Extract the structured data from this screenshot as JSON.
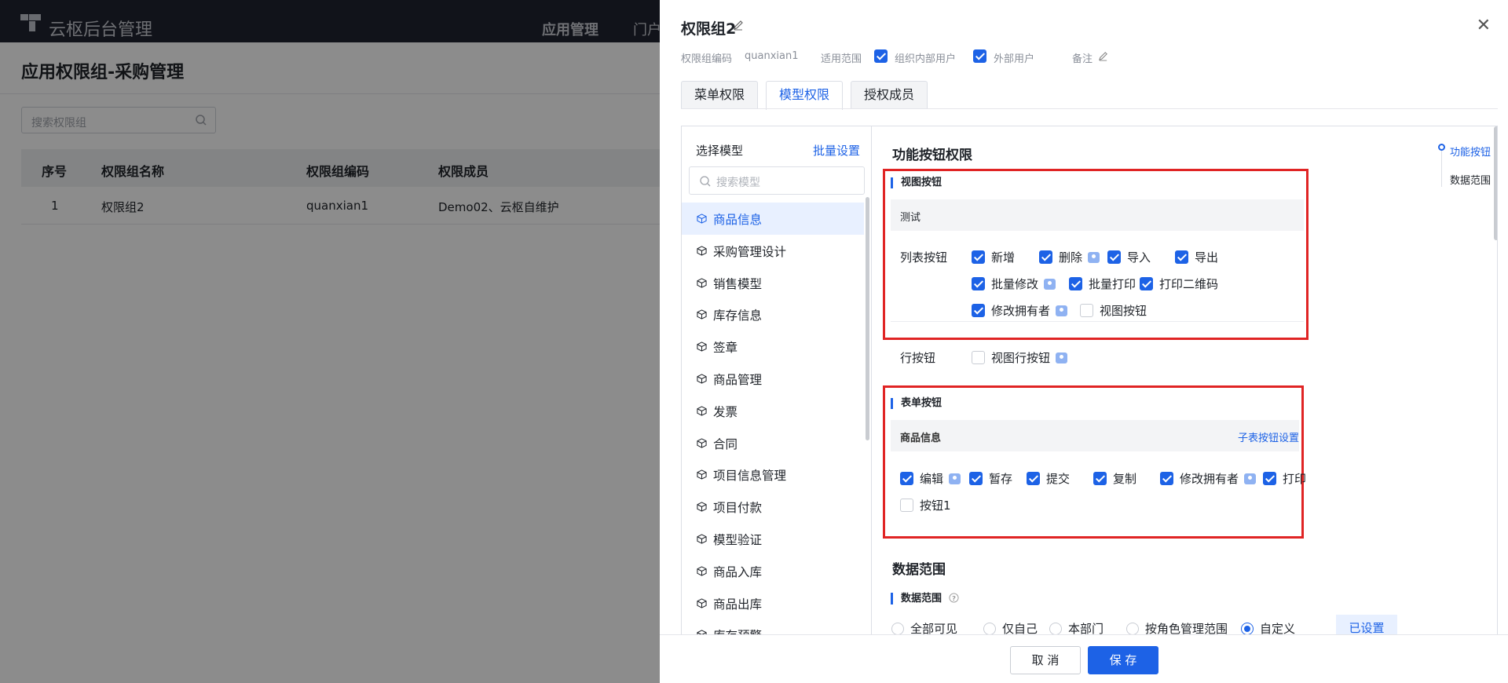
{
  "app": {
    "name": "云枢后台管理",
    "nav": [
      "应用管理",
      "门户"
    ]
  },
  "page": {
    "title": "应用权限组-采购管理",
    "search_placeholder": "搜索权限组",
    "table": {
      "headers": [
        "序号",
        "权限组名称",
        "权限组编码",
        "权限成员"
      ],
      "rows": [
        [
          "1",
          "权限组2",
          "quanxian1",
          "Demo02、云枢自维护"
        ]
      ]
    }
  },
  "drawer": {
    "title": "权限组2",
    "meta": {
      "code_label": "权限组编码",
      "code_value": "quanxian1",
      "scope_label": "适用范围",
      "scope_internal": "组织内部用户",
      "scope_external": "外部用户",
      "remark_label": "备注"
    },
    "tabs": [
      "菜单权限",
      "模型权限",
      "授权成员"
    ],
    "left": {
      "title": "选择模型",
      "batch": "批量设置",
      "search_placeholder": "搜索模型",
      "models": [
        "商品信息",
        "采购管理设计",
        "销售模型",
        "库存信息",
        "签章",
        "商品管理",
        "发票",
        "合同",
        "项目信息管理",
        "项目付款",
        "模型验证",
        "商品入库",
        "商品出库",
        "库存预警"
      ]
    },
    "right": {
      "func_title": "功能按钮权限",
      "anchors": [
        "功能按钮",
        "数据范围"
      ],
      "view_section": {
        "title": "视图按钮",
        "sub": "测试",
        "list_label": "列表按钮",
        "list_buttons": [
          {
            "label": "新增",
            "checked": true,
            "tip": false
          },
          {
            "label": "删除",
            "checked": true,
            "tip": true
          },
          {
            "label": "导入",
            "checked": true,
            "tip": false
          },
          {
            "label": "导出",
            "checked": true,
            "tip": false
          },
          {
            "label": "批量修改",
            "checked": true,
            "tip": true
          },
          {
            "label": "批量打印",
            "checked": true,
            "tip": false
          },
          {
            "label": "打印二维码",
            "checked": true,
            "tip": false
          },
          {
            "label": "修改拥有者",
            "checked": true,
            "tip": true
          },
          {
            "label": "视图按钮",
            "checked": false,
            "tip": false
          }
        ],
        "row_label": "行按钮",
        "row_buttons": [
          {
            "label": "视图行按钮",
            "checked": false,
            "tip": true
          }
        ]
      },
      "form_section": {
        "title": "表单按钮",
        "sub": "商品信息",
        "sub_link": "子表按钮设置",
        "buttons": [
          {
            "label": "编辑",
            "checked": true,
            "tip": true
          },
          {
            "label": "暂存",
            "checked": true,
            "tip": false
          },
          {
            "label": "提交",
            "checked": true,
            "tip": false
          },
          {
            "label": "复制",
            "checked": true,
            "tip": false
          },
          {
            "label": "修改拥有者",
            "checked": true,
            "tip": true
          },
          {
            "label": "打印",
            "checked": true,
            "tip": false
          },
          {
            "label": "按钮1",
            "checked": false,
            "tip": false
          }
        ]
      },
      "data_scope": {
        "title": "数据范围",
        "section": "数据范围",
        "options": [
          "全部可见",
          "仅自己",
          "本部门",
          "按角色管理范围",
          "自定义"
        ],
        "selected": "自定义",
        "set_button": "已设置"
      }
    },
    "footer": {
      "cancel": "取 消",
      "save": "保 存"
    }
  },
  "colors": {
    "accent": "#1d62e6",
    "highlight_box": "#e02424",
    "topbar": "#1f2431"
  }
}
